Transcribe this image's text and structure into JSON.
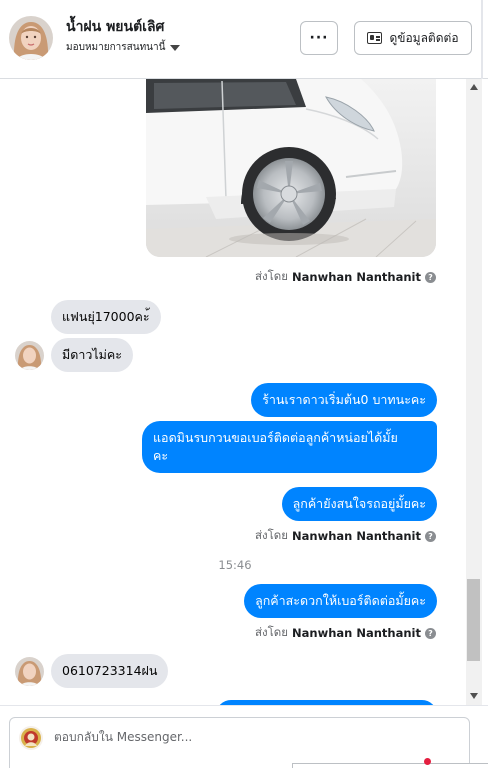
{
  "header": {
    "contact_name": "น้ำฝน พยนต์เลิศ",
    "assign_label": "มอบหมายการสนทนานี้",
    "more_label": "···",
    "contact_info_label": "ดูข้อมูลติดต่อ"
  },
  "messages": {
    "image_sent_prefix": "ส่งโดย",
    "image_sent_name": "Nanwhan Nanthanit",
    "in_1": "แฟนยุ่17000คะ้",
    "in_2": "มีดาวไม่คะ",
    "out_1": "ร้านเราดาวเริ่มต้น0 บาทนะคะ",
    "out_2a": "แอดมินรบกวนขอเบอร์ติดต่อลูกค้าหน่อยได้มั้ย",
    "out_2b": "คะ",
    "out_3": "ลูกค้ายังสนใจรถอยู่มั้ยคะ",
    "sent_prefix_2": "ส่งโดย",
    "sent_name_2": "Nanwhan Nanthanit",
    "timestamp": "15:46",
    "out_4": "ลูกค้าสะดวกให้เบอร์ติดต่อมั้ยคะ",
    "sent_prefix_3": "ส่งโดย",
    "sent_name_3": "Nanwhan Nanthanit",
    "in_3": "0610723314ฝน"
  },
  "composer": {
    "placeholder": "ตอบกลับใน Messenger..."
  },
  "icons": {
    "info": "?"
  },
  "colors": {
    "outgoing_bubble": "#0084ff",
    "incoming_bubble": "#e4e6eb",
    "notification_dot": "#e41e3f"
  }
}
